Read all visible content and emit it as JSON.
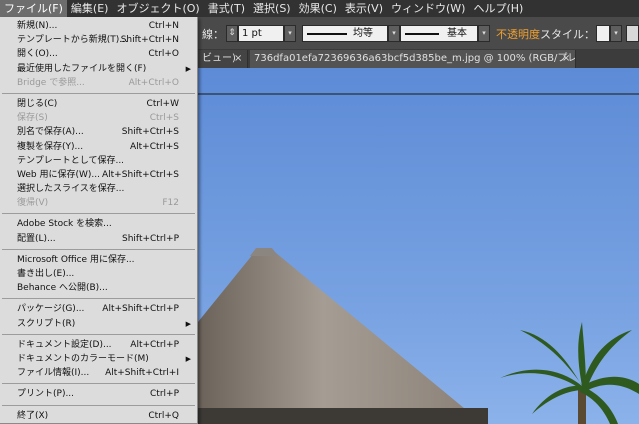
{
  "menubar": {
    "items": [
      {
        "label": "ファイル(F)",
        "active": true
      },
      {
        "label": "編集(E)"
      },
      {
        "label": "オブジェクト(O)"
      },
      {
        "label": "書式(T)"
      },
      {
        "label": "選択(S)"
      },
      {
        "label": "効果(C)"
      },
      {
        "label": "表示(V)"
      },
      {
        "label": "ウィンドウ(W)"
      },
      {
        "label": "ヘルプ(H)"
      }
    ]
  },
  "controlbar": {
    "stroke_label": "線：",
    "stroke_weight": "1 pt",
    "profile_label": "均等",
    "brush_label": "基本",
    "opacity_label": "不透明度",
    "style_label": "スタイル："
  },
  "tabs": {
    "first_tab_suffix": "ビュー)",
    "active_tab_title": "736dfa01efa72369636a63bcf5d385be_m.jpg @ 100% (RGB/プレビュー)",
    "close_symbol": "×"
  },
  "file_menu": {
    "groups": [
      [
        {
          "label": "新規(N)...",
          "shortcut": "Ctrl+N"
        },
        {
          "label": "テンプレートから新規(T)...",
          "shortcut": "Shift+Ctrl+N"
        },
        {
          "label": "開く(O)...",
          "shortcut": "Ctrl+O"
        },
        {
          "label": "最近使用したファイルを開く(F)",
          "submenu": true
        },
        {
          "label": "Bridge で参照...",
          "shortcut": "Alt+Ctrl+O",
          "disabled": true
        }
      ],
      [
        {
          "label": "閉じる(C)",
          "shortcut": "Ctrl+W"
        },
        {
          "label": "保存(S)",
          "shortcut": "Ctrl+S",
          "disabled": true
        },
        {
          "label": "別名で保存(A)...",
          "shortcut": "Shift+Ctrl+S"
        },
        {
          "label": "複製を保存(Y)...",
          "shortcut": "Alt+Ctrl+S"
        },
        {
          "label": "テンプレートとして保存..."
        },
        {
          "label": "Web 用に保存(W)...",
          "shortcut": "Alt+Shift+Ctrl+S"
        },
        {
          "label": "選択したスライスを保存..."
        },
        {
          "label": "復帰(V)",
          "shortcut": "F12",
          "disabled": true
        }
      ],
      [
        {
          "label": "Adobe Stock を検索..."
        },
        {
          "label": "配置(L)...",
          "shortcut": "Shift+Ctrl+P"
        }
      ],
      [
        {
          "label": "Microsoft Office 用に保存..."
        },
        {
          "label": "書き出し(E)..."
        },
        {
          "label": "Behance へ公開(B)..."
        }
      ],
      [
        {
          "label": "パッケージ(G)...",
          "shortcut": "Alt+Shift+Ctrl+P"
        },
        {
          "label": "スクリプト(R)",
          "submenu": true
        }
      ],
      [
        {
          "label": "ドキュメント設定(D)...",
          "shortcut": "Alt+Ctrl+P"
        },
        {
          "label": "ドキュメントのカラーモード(M)",
          "submenu": true
        },
        {
          "label": "ファイル情報(I)...",
          "shortcut": "Alt+Shift+Ctrl+I"
        }
      ],
      [
        {
          "label": "プリント(P)...",
          "shortcut": "Ctrl+P"
        }
      ],
      [
        {
          "label": "終了(X)",
          "shortcut": "Ctrl+Q"
        }
      ]
    ]
  },
  "icons": {
    "dropdown": "▾",
    "stepper": "⇕",
    "submenu": "▶"
  },
  "colors": {
    "sky": "#5a87d0",
    "menu_bg": "#dcdcdc",
    "opacity_accent": "#f0a030"
  }
}
